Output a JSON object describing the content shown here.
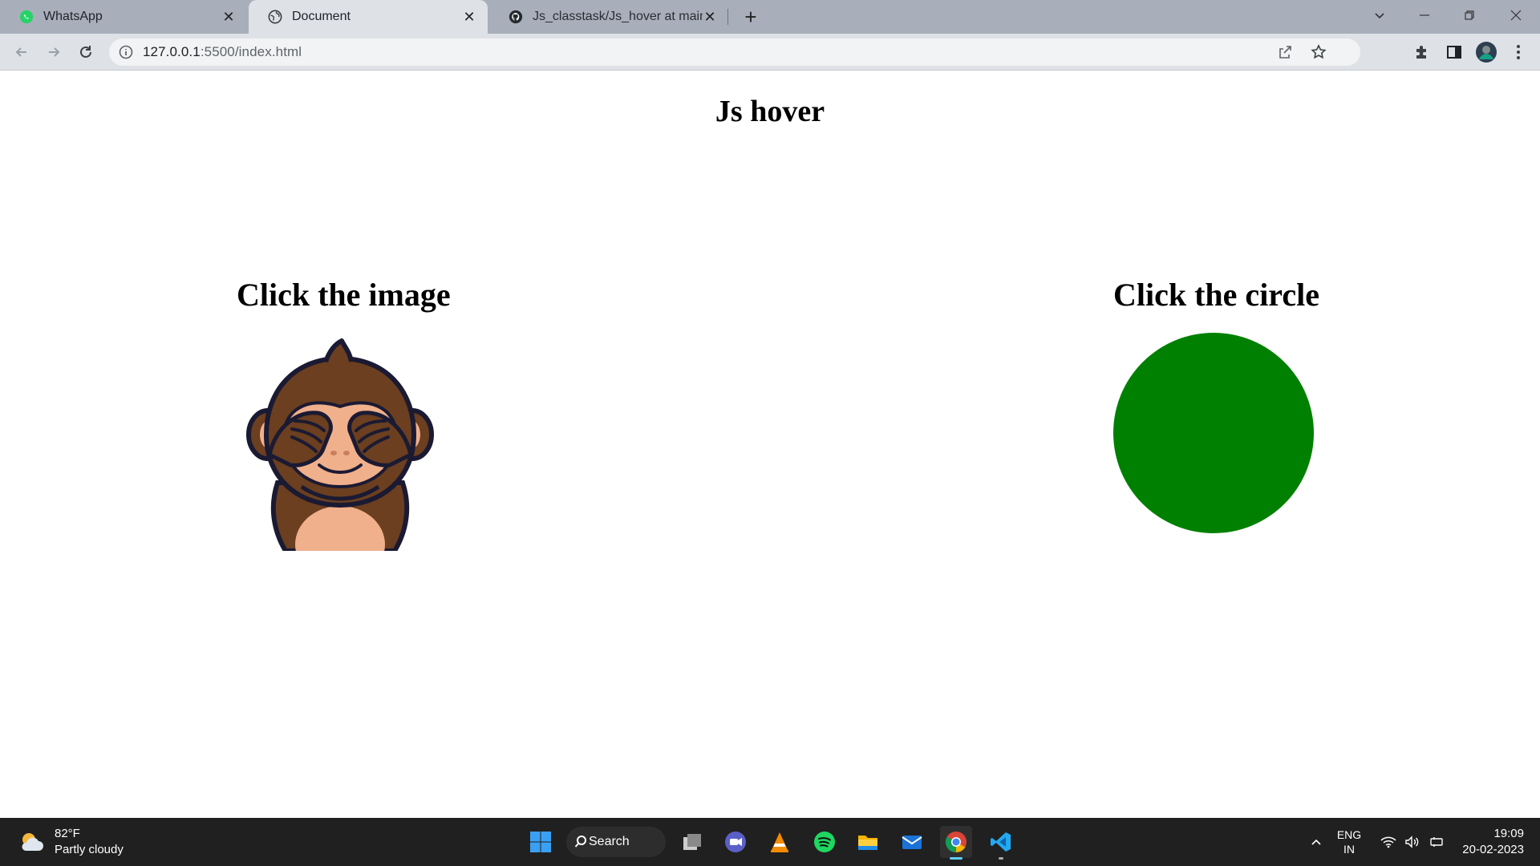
{
  "browser": {
    "tabs": [
      {
        "title": "WhatsApp",
        "icon": "whatsapp-icon",
        "active": false
      },
      {
        "title": "Document",
        "icon": "globe-icon",
        "active": true
      },
      {
        "title": "Js_classtask/Js_hover at main · Ro",
        "icon": "github-icon",
        "active": false
      }
    ],
    "new_tab_symbol": "+",
    "close_symbol": "✕",
    "address": {
      "host": "127.0.0.1",
      "rest": ":5500/index.html"
    }
  },
  "page": {
    "heading": "Js hover",
    "image_label": "Click the image",
    "circle_label": "Click the circle",
    "circle_color": "#008000"
  },
  "taskbar": {
    "weather_temp": "82°F",
    "weather_desc": "Partly cloudy",
    "search_label": "Search",
    "lang_top": "ENG",
    "lang_bottom": "IN",
    "time": "19:09",
    "date": "20-02-2023"
  }
}
